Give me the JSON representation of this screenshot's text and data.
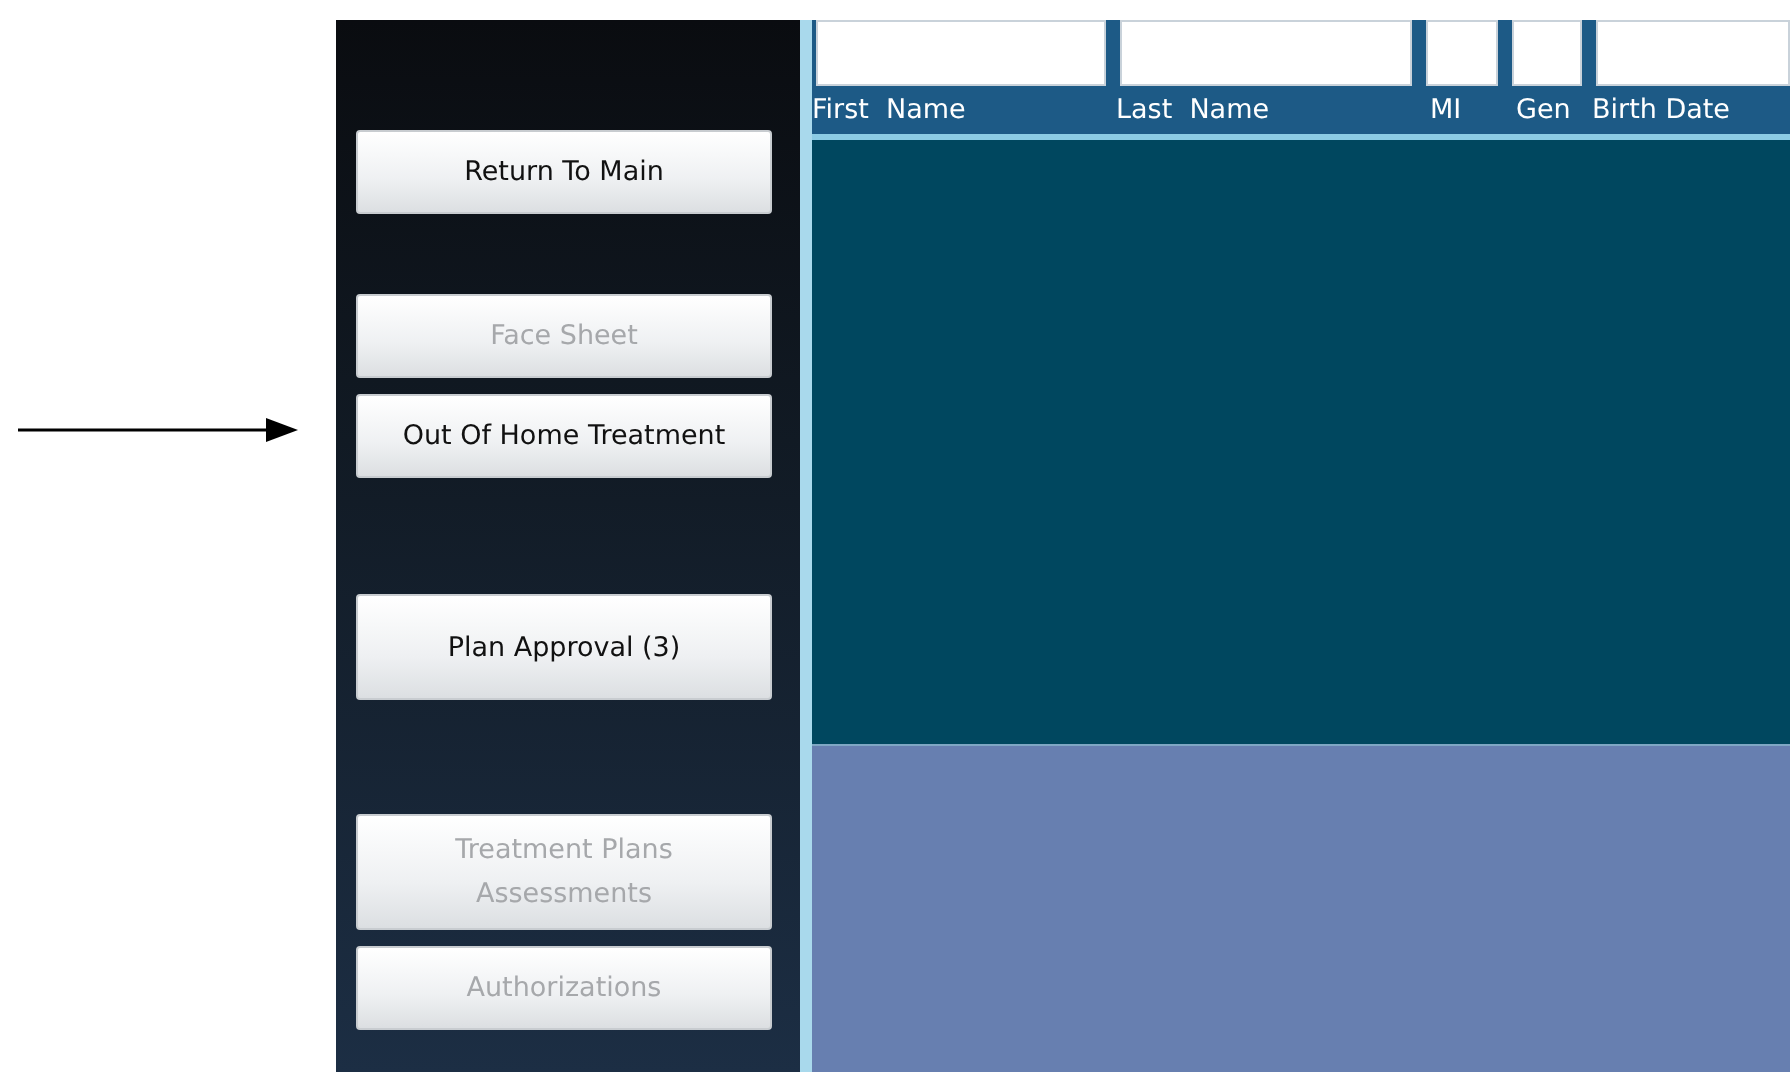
{
  "sidebar": {
    "groups": [
      {
        "buttons": [
          {
            "label": "Return To Main",
            "disabled": false
          }
        ]
      },
      {
        "buttons": [
          {
            "label": "Face Sheet",
            "disabled": true
          },
          {
            "label": "Out Of Home Treatment",
            "disabled": false
          }
        ]
      },
      {
        "buttons": [
          {
            "label": "Plan Approval (3)",
            "disabled": false
          }
        ]
      },
      {
        "buttons": [
          {
            "label": "Treatment Plans Assessments",
            "disabled": true
          },
          {
            "label": "Authorizations",
            "disabled": true
          }
        ]
      }
    ]
  },
  "search": {
    "columns": [
      {
        "label": "First  Name"
      },
      {
        "label": "Last  Name"
      },
      {
        "label": "MI"
      },
      {
        "label": "Gen"
      },
      {
        "label": "Birth Date"
      }
    ]
  }
}
